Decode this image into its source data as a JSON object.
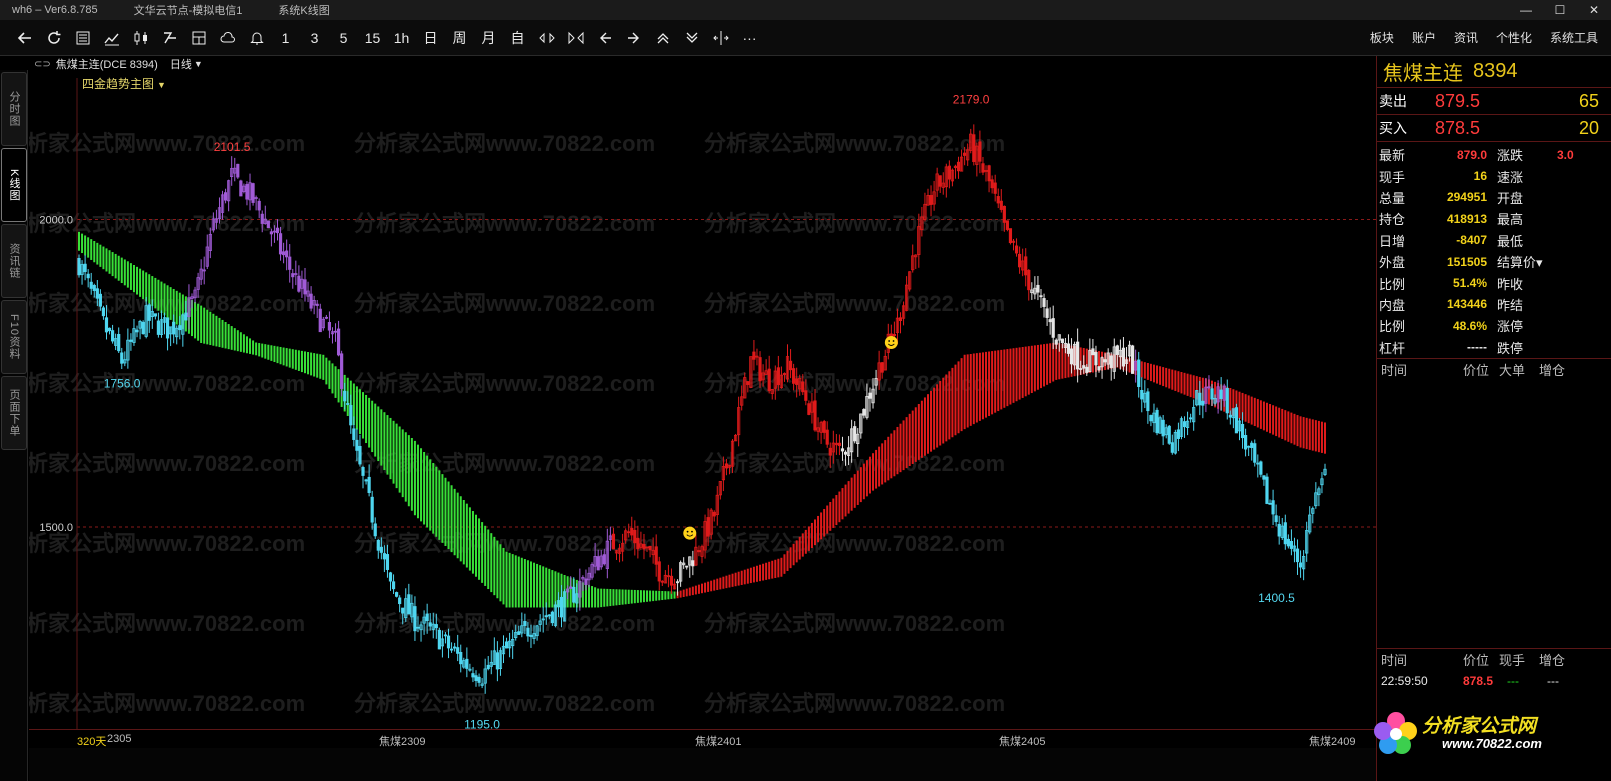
{
  "titlebar": {
    "app": "wh6 – Ver6.8.785",
    "server": "文华云节点-模拟电信1",
    "view": "系统K线图",
    "window_buttons": [
      "—",
      "☐",
      "✕"
    ]
  },
  "toolbar": {
    "periods": [
      "1",
      "3",
      "5",
      "15",
      "1h",
      "日",
      "周",
      "月",
      "自"
    ],
    "more": "···",
    "menus": [
      "板块",
      "账户",
      "资讯",
      "个性化",
      "系统工具"
    ]
  },
  "sidetabs": [
    "分时图",
    "K线图",
    "资讯链",
    "F10资料",
    "页面下单"
  ],
  "chart_header": {
    "symbol": "焦煤主连(DCE 8394)",
    "period": "日线",
    "indicator": "四金趋势主图"
  },
  "watermark": "分析家公式网www.70822.com",
  "price_labels": [
    "2000.0",
    "1500.0"
  ],
  "bar_count_label": "320天",
  "extreme_labels": {
    "high_left": "2101.5",
    "low_left": "1756.0",
    "high_mid": "2179.0",
    "low_mid": "1195.0",
    "low_right": "1400.5"
  },
  "x_labels": [
    "2305",
    "焦煤2309",
    "焦煤2401",
    "焦煤2405",
    "焦煤2409"
  ],
  "chart_data": {
    "type": "candlestick",
    "title": "",
    "xlabel": "",
    "ylabel": "",
    "ylim": [
      1170,
      2230
    ],
    "gridlines_y": [
      2000,
      1500
    ],
    "marked_values": [
      2101.5,
      1756.0,
      2179.0,
      1195.0,
      1400.5
    ],
    "colors": {
      "candle_up_red": "#e01b1b",
      "candle_down_cyan": "#4fd6f0",
      "candle_purple": "#a05bd6",
      "candle_white": "#e6e6e6",
      "band_green": "#38e038",
      "band_red": "#e01b1b"
    },
    "close_path": [
      [
        0,
        1930
      ],
      [
        8,
        1830
      ],
      [
        14,
        1770
      ],
      [
        22,
        1840
      ],
      [
        30,
        1820
      ],
      [
        38,
        1870
      ],
      [
        44,
        1990
      ],
      [
        50,
        2070
      ],
      [
        56,
        2040
      ],
      [
        62,
        1990
      ],
      [
        68,
        1930
      ],
      [
        76,
        1860
      ],
      [
        84,
        1800
      ],
      [
        90,
        1630
      ],
      [
        96,
        1520
      ],
      [
        102,
        1400
      ],
      [
        110,
        1350
      ],
      [
        118,
        1320
      ],
      [
        126,
        1280
      ],
      [
        132,
        1260
      ],
      [
        140,
        1300
      ],
      [
        148,
        1340
      ],
      [
        154,
        1360
      ],
      [
        160,
        1380
      ],
      [
        166,
        1420
      ],
      [
        174,
        1470
      ],
      [
        180,
        1490
      ],
      [
        186,
        1460
      ],
      [
        190,
        1430
      ],
      [
        196,
        1420
      ],
      [
        202,
        1460
      ],
      [
        208,
        1520
      ],
      [
        214,
        1640
      ],
      [
        220,
        1770
      ],
      [
        226,
        1740
      ],
      [
        232,
        1760
      ],
      [
        238,
        1710
      ],
      [
        244,
        1640
      ],
      [
        250,
        1620
      ],
      [
        256,
        1680
      ],
      [
        262,
        1760
      ],
      [
        268,
        1830
      ],
      [
        274,
        1960
      ],
      [
        280,
        2050
      ],
      [
        286,
        2080
      ],
      [
        292,
        2120
      ],
      [
        298,
        2060
      ],
      [
        304,
        1970
      ],
      [
        312,
        1890
      ],
      [
        320,
        1810
      ],
      [
        328,
        1770
      ],
      [
        336,
        1770
      ],
      [
        344,
        1780
      ],
      [
        350,
        1690
      ],
      [
        358,
        1640
      ],
      [
        366,
        1710
      ],
      [
        374,
        1720
      ],
      [
        380,
        1660
      ],
      [
        388,
        1560
      ],
      [
        394,
        1490
      ],
      [
        400,
        1440
      ],
      [
        404,
        1540
      ],
      [
        408,
        1580
      ]
    ],
    "band": [
      [
        0,
        1980,
        1950
      ],
      [
        40,
        1860,
        1800
      ],
      [
        58,
        1800,
        1780
      ],
      [
        80,
        1780,
        1740
      ],
      [
        110,
        1640,
        1520
      ],
      [
        140,
        1460,
        1370
      ],
      [
        170,
        1400,
        1370
      ],
      [
        196,
        1395,
        1385
      ],
      [
        230,
        1450,
        1420
      ],
      [
        260,
        1620,
        1560
      ],
      [
        290,
        1780,
        1660
      ],
      [
        320,
        1800,
        1740
      ],
      [
        340,
        1780,
        1760
      ],
      [
        370,
        1740,
        1700
      ],
      [
        400,
        1680,
        1630
      ],
      [
        408,
        1670,
        1620
      ]
    ],
    "band_color_switch_index": 196
  },
  "quote": {
    "name": "焦煤主连",
    "code": "8394",
    "orderbook": [
      {
        "label": "卖出",
        "price": "879.5",
        "volume": "65"
      },
      {
        "label": "买入",
        "price": "878.5",
        "volume": "20"
      }
    ],
    "rows": [
      {
        "k1": "最新",
        "v1": "879.0",
        "c1": "#ff3b3b",
        "k2": "涨跌",
        "v2": "3.0"
      },
      {
        "k1": "现手",
        "v1": "16",
        "c1": "#f2d21a",
        "k2": "速涨",
        "v2": ""
      },
      {
        "k1": "总量",
        "v1": "294951",
        "c1": "#f2d21a",
        "k2": "开盘",
        "v2": ""
      },
      {
        "k1": "持仓",
        "v1": "418913",
        "c1": "#f2d21a",
        "k2": "最高",
        "v2": ""
      },
      {
        "k1": "日增",
        "v1": "-8407",
        "c1": "#f2d21a",
        "k2": "最低",
        "v2": ""
      },
      {
        "k1": "外盘",
        "v1": "151505",
        "c1": "#f2d21a",
        "k2": "结算价▾",
        "v2": ""
      },
      {
        "k1": "比例",
        "v1": "51.4%",
        "c1": "#f2d21a",
        "k2": "昨收",
        "v2": ""
      },
      {
        "k1": "内盘",
        "v1": "143446",
        "c1": "#f2d21a",
        "k2": "昨结",
        "v2": ""
      },
      {
        "k1": "比例",
        "v1": "48.6%",
        "c1": "#f2d21a",
        "k2": "涨停",
        "v2": ""
      },
      {
        "k1": "杠杆",
        "v1": "-----",
        "c1": "#e8e8e8",
        "k2": "跌停",
        "v2": ""
      }
    ],
    "big_orders_header": [
      "时间",
      "价位",
      "大单",
      "增仓"
    ],
    "ticks_header": [
      "时间",
      "价位",
      "现手",
      "增仓"
    ],
    "ticks": [
      {
        "time": "22:59:50",
        "price": "878.5",
        "vol": "---",
        "oi": "---"
      }
    ]
  },
  "logo": {
    "brand": "分析家公式网",
    "url": "www.70822.com"
  }
}
